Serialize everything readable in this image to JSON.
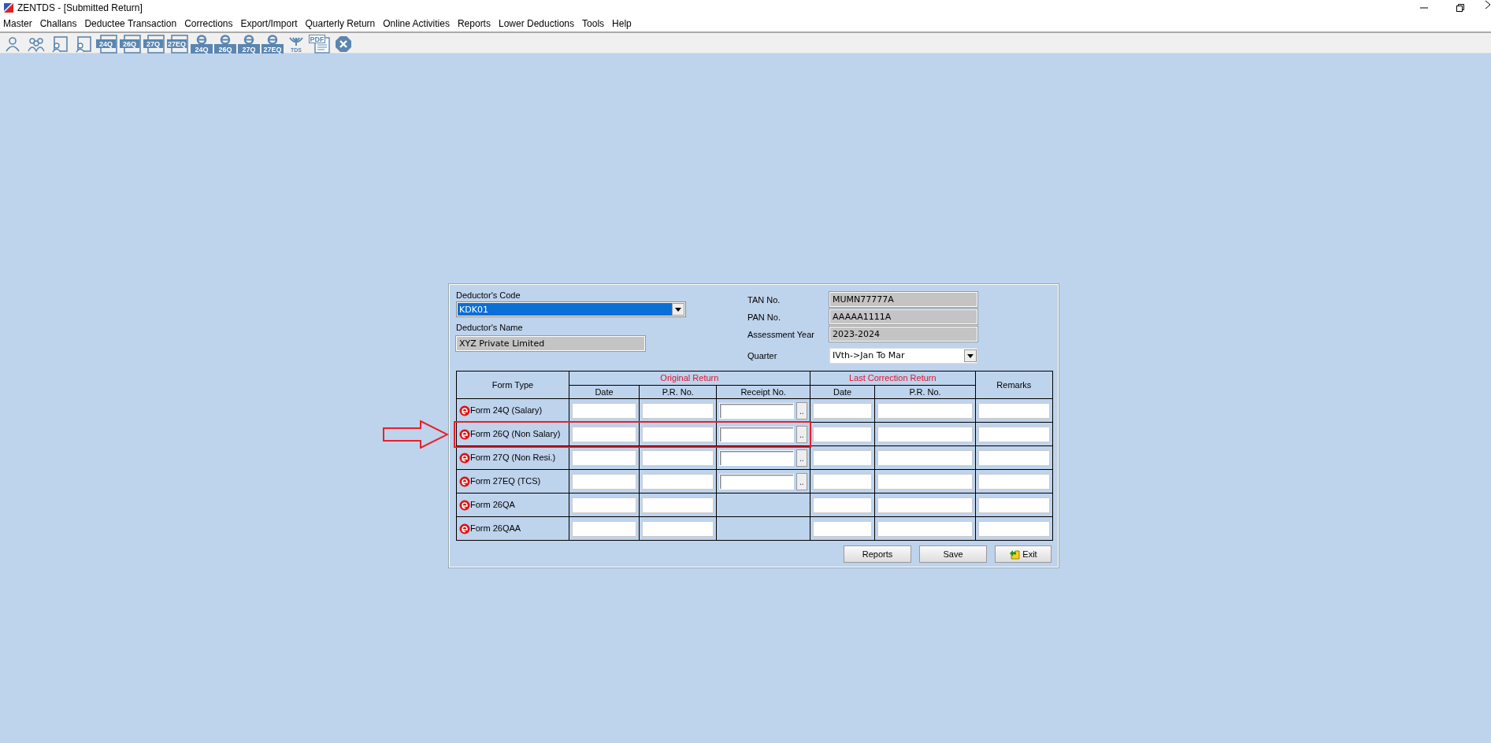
{
  "window": {
    "title": "ZENTDS - [Submitted Return]"
  },
  "menu": [
    "Master",
    "Challans",
    "Deductee Transaction",
    "Corrections",
    "Export/Import",
    "Quarterly Return",
    "Online Activities",
    "Reports",
    "Lower Deductions",
    "Tools",
    "Help"
  ],
  "toolbar": [
    {
      "kind": "person"
    },
    {
      "kind": "people"
    },
    {
      "kind": "doc-person"
    },
    {
      "kind": "doc-person"
    },
    {
      "kind": "form",
      "label": "24Q"
    },
    {
      "kind": "form",
      "label": "26Q"
    },
    {
      "kind": "form",
      "label": "27Q"
    },
    {
      "kind": "form",
      "label": "27EQ"
    },
    {
      "kind": "eform",
      "label": "24Q"
    },
    {
      "kind": "eform",
      "label": "26Q"
    },
    {
      "kind": "eform",
      "label": "27Q"
    },
    {
      "kind": "eform",
      "label": "27EQ"
    },
    {
      "kind": "tds",
      "label": "TDS"
    },
    {
      "kind": "pdf",
      "label": "PDF"
    },
    {
      "kind": "close"
    }
  ],
  "deductor": {
    "code_label": "Deductor's Code",
    "code": "KDK01",
    "name_label": "Deductor's Name",
    "name": "XYZ Private Limited"
  },
  "info": [
    {
      "kind": "text",
      "label": "TAN No.",
      "value": "MUMN77777A"
    },
    {
      "kind": "text",
      "label": "PAN No.",
      "value": "AAAAA1111A"
    },
    {
      "kind": "text",
      "label": "Assessment Year",
      "value": "2023-2024"
    },
    {
      "kind": "select",
      "label": "Quarter",
      "value": "IVth->Jan To Mar"
    }
  ],
  "table": {
    "form_type_header": "Form Type",
    "original_header": "Original Return",
    "correction_header": "Last Correction Return",
    "remarks_header": "Remarks",
    "original_columns": [
      "Date",
      "P.R. No.",
      "Receipt No."
    ],
    "correction_columns": [
      "Date",
      "P.R. No."
    ],
    "rows": [
      {
        "form": "Form 24Q (Salary)",
        "kind": "receipt",
        "highlighted": false
      },
      {
        "form": "Form 26Q (Non Salary)",
        "kind": "receipt",
        "highlighted": true
      },
      {
        "form": "Form 27Q (Non Resi.)",
        "kind": "receipt",
        "highlighted": false
      },
      {
        "form": "Form 27EQ (TCS)",
        "kind": "receipt",
        "highlighted": false
      },
      {
        "form": "Form 26QA",
        "kind": "plain",
        "highlighted": false
      },
      {
        "form": "Form 26QAA",
        "kind": "plain",
        "highlighted": false
      }
    ],
    "browse_label": ".."
  },
  "buttons": [
    {
      "label": "Reports",
      "kind": "plain"
    },
    {
      "label": "Save",
      "kind": "plain"
    },
    {
      "label": "Exit",
      "kind": "exit"
    }
  ]
}
